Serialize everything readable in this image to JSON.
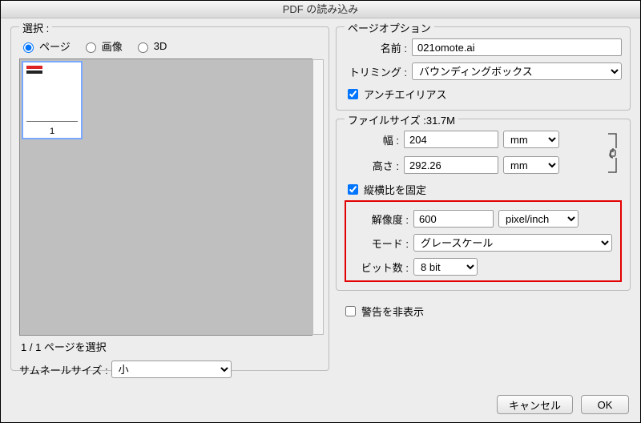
{
  "dialog": {
    "title": "PDF の読み込み"
  },
  "select": {
    "group_label": "選択 :",
    "radio_page": "ページ",
    "radio_image": "画像",
    "radio_3d": "3D",
    "thumb_page_num": "1",
    "status": "1 / 1 ページを選択",
    "thumb_size_label": "サムネールサイズ :",
    "thumb_size_value": "小"
  },
  "pageopt": {
    "group_label": "ページオプション",
    "name_label": "名前 :",
    "name_value": "021omote.ai",
    "trimming_label": "トリミング :",
    "trimming_value": "バウンディングボックス",
    "antialias_label": "アンチエイリアス"
  },
  "filesize": {
    "group_label": "ファイルサイズ :31.7M",
    "width_label": "幅 :",
    "width_value": "204",
    "width_unit": "mm",
    "height_label": "高さ :",
    "height_value": "292.26",
    "height_unit": "mm",
    "constrain_label": "縦横比を固定",
    "resolution_label": "解像度 :",
    "resolution_value": "600",
    "resolution_unit": "pixel/inch",
    "mode_label": "モード :",
    "mode_value": "グレースケール",
    "bitdepth_label": "ビット数 :",
    "bitdepth_value": "8 bit"
  },
  "warn": {
    "suppress_label": "警告を非表示"
  },
  "buttons": {
    "cancel": "キャンセル",
    "ok": "OK"
  }
}
